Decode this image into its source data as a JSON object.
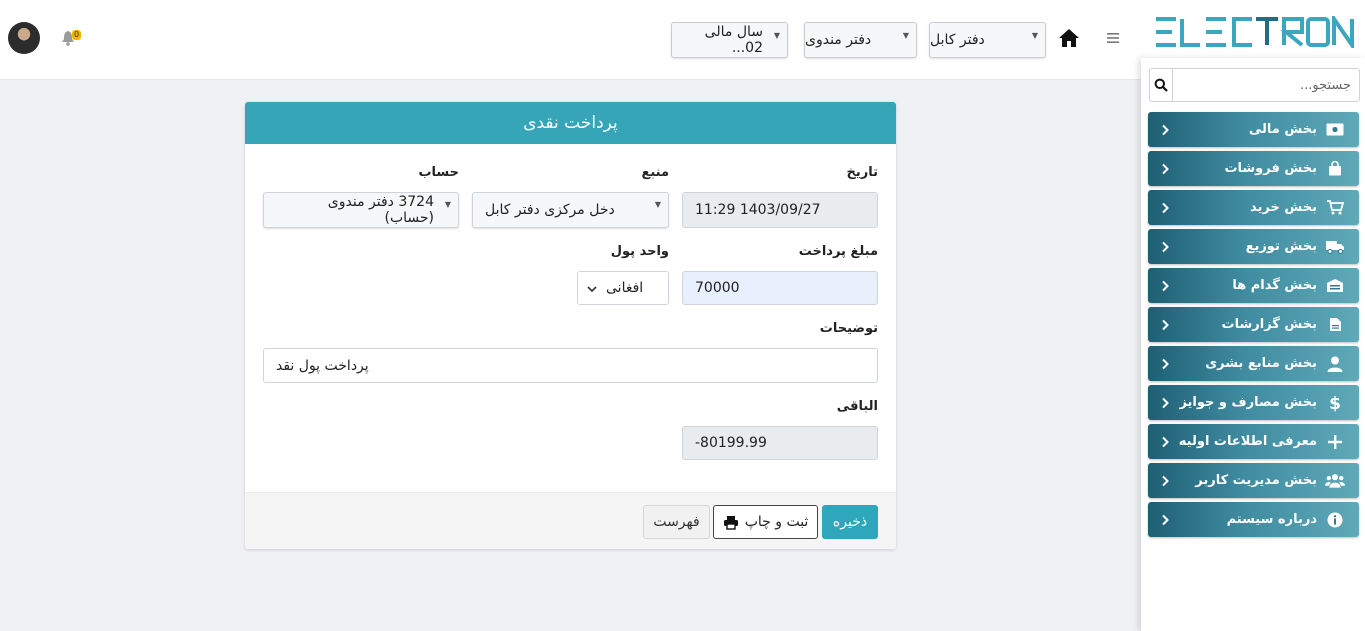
{
  "header": {
    "fiscal_year": "سال مالی 02...",
    "office": "دفتر مندوی",
    "branch": "دفتر کابل",
    "bell_count": "0",
    "logo_text": "ELECTRON"
  },
  "sidebar": {
    "search_placeholder": "جستجو...",
    "items": [
      {
        "label": "بخش مالی",
        "icon": "money-icon"
      },
      {
        "label": "بخش فروشات",
        "icon": "shopping-bag-icon"
      },
      {
        "label": "بخش خرید",
        "icon": "cart-icon"
      },
      {
        "label": "بخش توزیع",
        "icon": "truck-icon"
      },
      {
        "label": "بخش گدام ها",
        "icon": "warehouse-icon"
      },
      {
        "label": "بخش گزارشات",
        "icon": "file-icon"
      },
      {
        "label": "بخش منابع بشری",
        "icon": "user-icon"
      },
      {
        "label": "بخش مصارف و جوایز",
        "icon": "dollar-icon"
      },
      {
        "label": "معرفی اطلاعات اولیه",
        "icon": "plus-icon"
      },
      {
        "label": "بخش مدیریت کاربر",
        "icon": "users-icon"
      },
      {
        "label": "درباره سیستم",
        "icon": "info-icon"
      }
    ]
  },
  "form": {
    "title": "پرداخت نقدی",
    "date_label": "تاریخ",
    "date_value": "1403/09/27 11:29",
    "source_label": "منبع",
    "source_value": "دخل مرکزی دفتر کابل",
    "account_label": "حساب",
    "account_value": "3724 دفتر مندوی (حساب)",
    "amount_label": "مبلغ پرداخت",
    "amount_value": "70000",
    "currency_label": "واحد پول",
    "currency_value": "افغانی",
    "description_label": "توضیحات",
    "description_value": "پرداخت پول نقد",
    "balance_label": "الباقی",
    "balance_value": "-80199.99"
  },
  "buttons": {
    "save": "ذخیره",
    "print_save": "ثبت و چاپ",
    "list": "فهرست"
  }
}
